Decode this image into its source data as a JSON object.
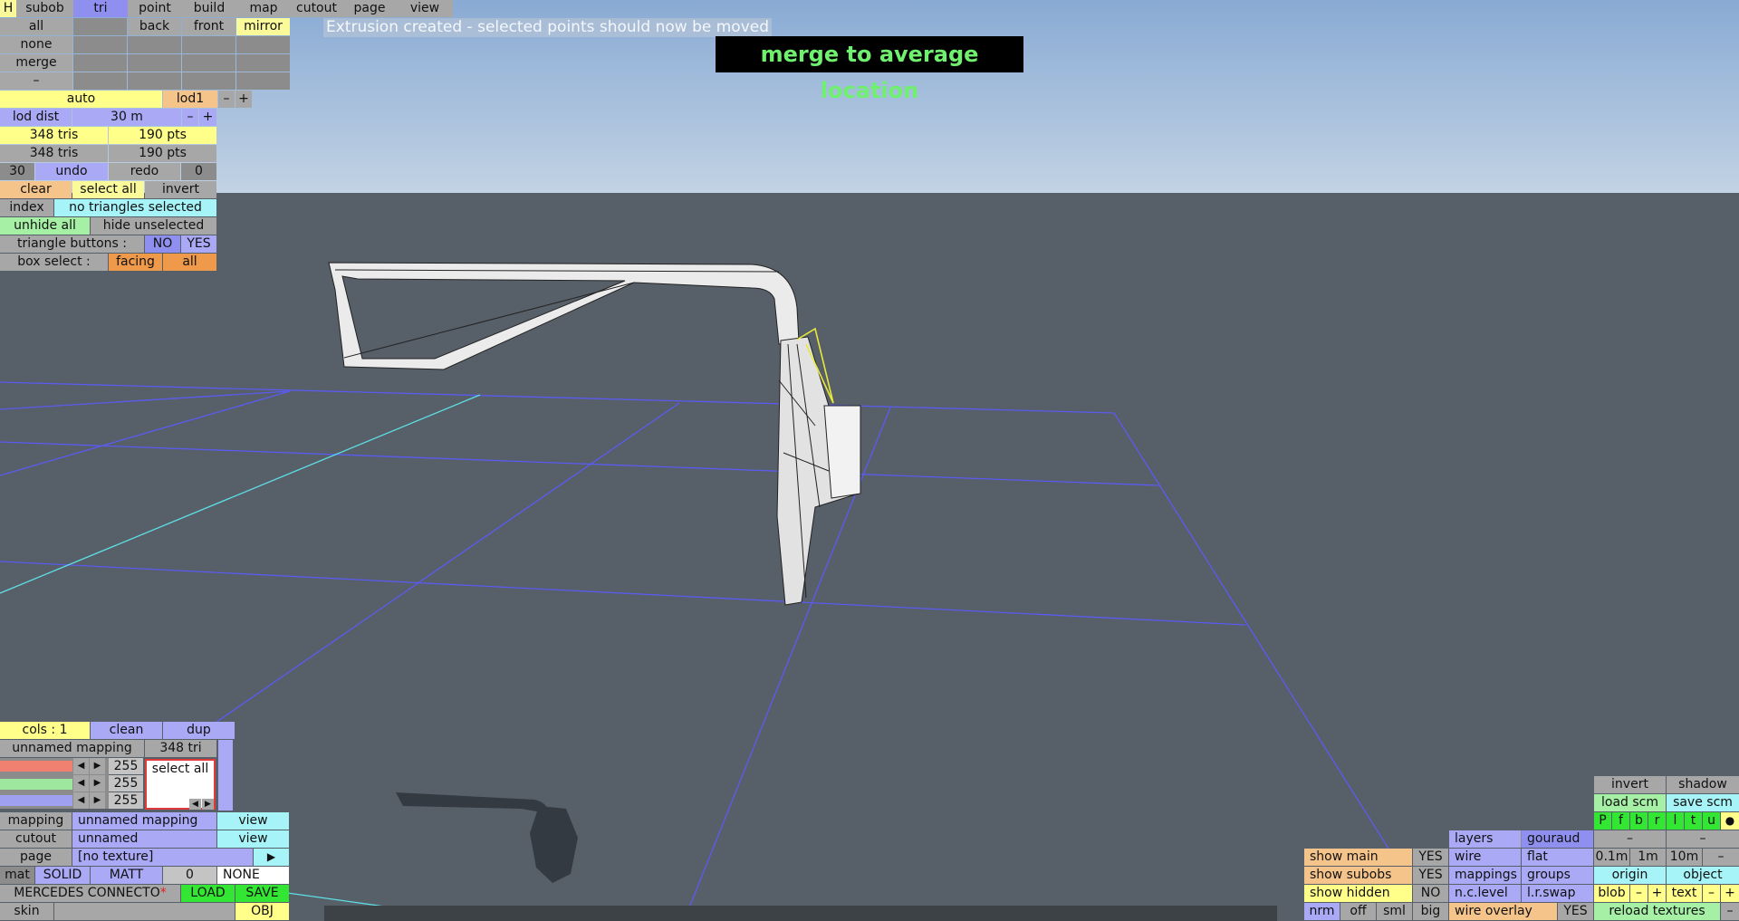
{
  "status_message": "Extrusion created - selected points should now be moved",
  "toast": "merge to average location",
  "top_menu": [
    "H",
    "subob",
    "tri",
    "point",
    "build",
    "map",
    "cutout",
    "page",
    "view"
  ],
  "select_rows": {
    "all": "all",
    "none": "none",
    "merge": "merge",
    "dash": "–",
    "back": "back",
    "front": "front",
    "mirror": "mirror"
  },
  "lod": {
    "auto": "auto",
    "lod1": "lod1",
    "minus": "–",
    "plus": "+",
    "label": "lod dist",
    "value": "30 m"
  },
  "stats": {
    "tris1": "348 tris",
    "pts1": "190 pts",
    "tris2": "348 tris",
    "pts2": "190 pts"
  },
  "history": {
    "count": "30",
    "undo": "undo",
    "redo": "redo",
    "redo_count": "0"
  },
  "selection": {
    "clear": "clear",
    "select_all": "select all",
    "invert": "invert",
    "index": "index",
    "info": "no triangles selected",
    "unhide_all": "unhide all",
    "hide_unselected": "hide unselected",
    "tri_buttons": "triangle buttons :",
    "no": "NO",
    "yes": "YES",
    "box_select": "box select :",
    "facing": "facing",
    "all": "all"
  },
  "cols": {
    "label": "cols : 1",
    "clean": "clean",
    "dup": "dup"
  },
  "mapping_panel": {
    "name": "unnamed mapping",
    "tri_count": "348 tri",
    "r": "255",
    "g": "255",
    "b": "255",
    "select_all": "select all",
    "left": "◀",
    "right": "▶"
  },
  "props": {
    "mapping_label": "mapping",
    "mapping_value": "unnamed mapping",
    "view": "view",
    "cutout_label": "cutout",
    "cutout_value": "unnamed",
    "page_label": "page",
    "page_value": "[no texture]",
    "play": "▶",
    "mat": "mat",
    "solid": "SOLID",
    "matt": "MATT",
    "mat_num": "0",
    "none": "NONE",
    "model_name": "MERCEDES CONNECTO",
    "modified_mark": "*",
    "load": "LOAD",
    "save": "SAVE",
    "skin": "skin",
    "obj": "OBJ"
  },
  "display": {
    "invert": "invert",
    "shadow": "shadow",
    "load_scm": "load scm",
    "save_scm": "save scm",
    "views": [
      "P",
      "f",
      "b",
      "r",
      "l",
      "t",
      "u"
    ],
    "dot": "●",
    "dash": "–",
    "layers": "layers",
    "gouraud": "gouraud",
    "show_main": "show main",
    "yes": "YES",
    "wire": "wire",
    "flat": "flat",
    "g01": "0.1m",
    "g1": "1m",
    "g10": "10m",
    "minus": "–",
    "plus": "+",
    "show_subobs": "show subobs",
    "mappings": "mappings",
    "groups": "groups",
    "origin": "origin",
    "object": "object",
    "show_hidden": "show hidden",
    "no": "NO",
    "nc_level": "n.c.level",
    "lr_swap": "l.r.swap",
    "blob": "blob",
    "text": "text",
    "nrm": "nrm",
    "off": "off",
    "sml": "sml",
    "big": "big",
    "wire_overlay": "wire overlay",
    "reload_textures": "reload textures"
  },
  "colors": {
    "sky_top": "#8cadd6",
    "sky_bottom": "#bcd0e4",
    "ground": "#575f68",
    "grid": "#5b5bf0",
    "axis": "#5de0e6",
    "selection": "#e8e83a",
    "shadow": "#333a42"
  }
}
